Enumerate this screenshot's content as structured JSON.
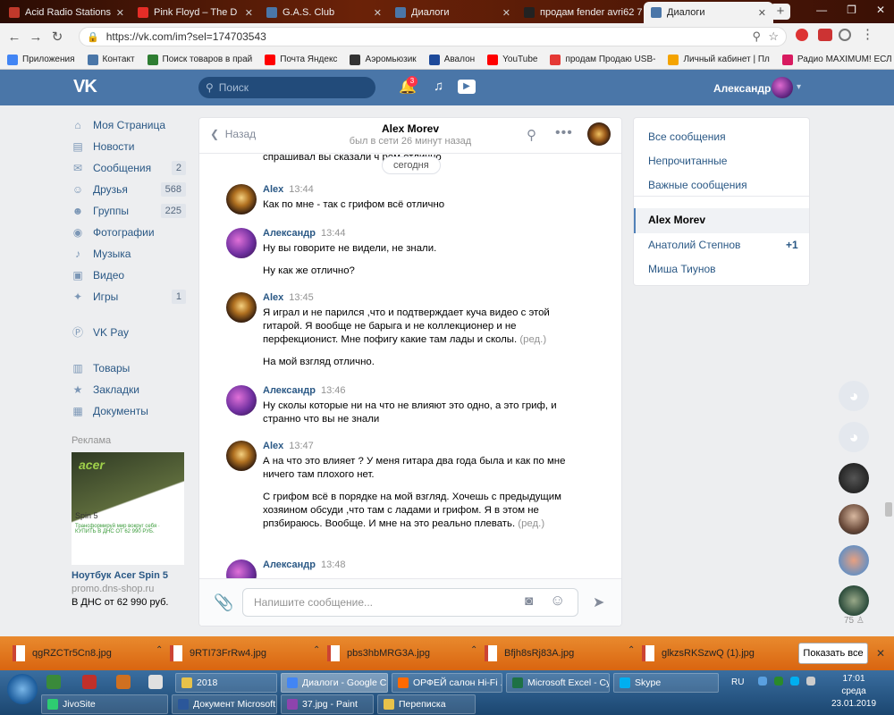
{
  "browser": {
    "tabs": [
      {
        "label": "Acid Radio Stations",
        "color": "#c0392b"
      },
      {
        "label": "Pink Floyd – The D",
        "color": "#e52d27"
      },
      {
        "label": "G.A.S. Club",
        "color": "#4a76a8"
      },
      {
        "label": "Диалоги",
        "color": "#4a76a8"
      },
      {
        "label": "продам fender avri62 7",
        "color": "#222222"
      },
      {
        "label": "Диалоги",
        "color": "#4a76a8"
      }
    ],
    "url": "https://vk.com/im?sel=174703543",
    "bookmarks": [
      {
        "label": "Приложения",
        "color": "#4285f4"
      },
      {
        "label": "Контакт",
        "color": "#4a76a8"
      },
      {
        "label": "Поиск товаров в прай",
        "color": "#2e7d32"
      },
      {
        "label": "Почта Яндекс",
        "color": "#ff0000"
      },
      {
        "label": "Аэромьюзик",
        "color": "#333333"
      },
      {
        "label": "Авалон",
        "color": "#1e4a9a"
      },
      {
        "label": "YouTube",
        "color": "#ff0000"
      },
      {
        "label": "продам Продаю USB-",
        "color": "#e53935"
      },
      {
        "label": "Личный кабинет | Пл",
        "color": "#f4a300"
      },
      {
        "label": "Радио MAXIMUM! ЕСЛ",
        "color": "#d81b60"
      }
    ]
  },
  "vk": {
    "logo": "VK",
    "search_placeholder": "Поиск",
    "notif_count": "3",
    "user_name": "Александр",
    "nav": [
      {
        "label": "Моя Страница",
        "icon": "home-icon",
        "count": ""
      },
      {
        "label": "Новости",
        "icon": "news-icon",
        "count": ""
      },
      {
        "label": "Сообщения",
        "icon": "messages-icon",
        "count": "2"
      },
      {
        "label": "Друзья",
        "icon": "friends-icon",
        "count": "568"
      },
      {
        "label": "Группы",
        "icon": "groups-icon",
        "count": "225"
      },
      {
        "label": "Фотографии",
        "icon": "photo-icon",
        "count": ""
      },
      {
        "label": "Музыка",
        "icon": "music-icon",
        "count": ""
      },
      {
        "label": "Видео",
        "icon": "video-icon",
        "count": ""
      },
      {
        "label": "Игры",
        "icon": "games-icon",
        "count": "1"
      },
      {
        "label": "VK Pay",
        "icon": "vkpay-icon",
        "count": ""
      },
      {
        "label": "Товары",
        "icon": "goods-icon",
        "count": ""
      },
      {
        "label": "Закладки",
        "icon": "bookmark-icon",
        "count": ""
      },
      {
        "label": "Документы",
        "icon": "docs-icon",
        "count": ""
      }
    ],
    "ad": {
      "title": "Реклама",
      "brand": "acer",
      "model": "Spin 5",
      "promo": "Трансформируй мир вокруг себя · КУПИТЬ В ДНС ОТ 62 990 РУБ.",
      "name": "Ноутбук Acer Spin 5",
      "domain": "promo.dns-shop.ru",
      "price": "В ДНС от 62 990 руб."
    }
  },
  "chat": {
    "back_label": "Назад",
    "name": "Alex Morev",
    "status": "был в сети 26 минут назад",
    "date_badge": "сегодня",
    "scrolled_line": "спрашивал вы сказали ч                 ром отлично",
    "edited_label": "(ред.)",
    "messages": [
      {
        "author": "Alex",
        "time": "13:44",
        "lines": [
          "Как по мне - так с грифом всё отлично"
        ]
      },
      {
        "author": "Александр",
        "time": "13:44",
        "lines": [
          "Ну вы говорите не видели, не знали.",
          "Ну как же отлично?"
        ]
      },
      {
        "author": "Alex",
        "time": "13:45",
        "lines": [
          "Я играл и не парился ,что и подтверждает куча видео с этой гитарой. Я вообще не барыга и не коллекционер и не перфекционист. Мне пофигу какие там лады и сколы.",
          "На мой взгляд отлично."
        ]
      },
      {
        "author": "Александр",
        "time": "13:46",
        "lines": [
          "Ну сколы которые ни на что не влияют это одно, а это гриф, и странно что вы не знали"
        ]
      },
      {
        "author": "Alex",
        "time": "13:47",
        "lines": [
          "А на что это влияет ? У меня гитара два года была и как по мне ничего там плохого нет.",
          "С грифом всё в порядке на мой взгляд. Хочешь с предыдущим хозяином обсуди ,что там с ладами и грифом. Я в этом не рпзбираюсь. Вообще. И мне на это реально плевать."
        ]
      },
      {
        "author": "Александр",
        "time": "13:48",
        "lines": [
          ""
        ]
      }
    ],
    "input_placeholder": "Напишите сообщение..."
  },
  "right_panel": {
    "filters": [
      "Все сообщения",
      "Непрочитанные",
      "Важные сообщения"
    ],
    "dialogs": [
      {
        "name": "Alex Morev",
        "count": ""
      },
      {
        "name": "Анатолий Степнов",
        "count": "+1"
      },
      {
        "name": "Миша Тиунов",
        "count": ""
      }
    ]
  },
  "friends_bar": {
    "online_count": "75"
  },
  "downloads": {
    "files": [
      "qgRZCTr5Cn8.jpg",
      "9RTI73FrRw4.jpg",
      "pbs3hbMRG3A.jpg",
      "Bfjh8sRj83A.jpg",
      "glkzsRKSzwQ (1).jpg"
    ],
    "show_all": "Показать все"
  },
  "taskbar": {
    "row1": [
      {
        "label": "2018",
        "color": "#e8c24a"
      },
      {
        "label": "Диалоги - Google C...",
        "color": "#4285f4"
      },
      {
        "label": "ОРФЕЙ салон Hi-Fi ...",
        "color": "#ff6a00"
      },
      {
        "label": "Microsoft Excel - Су...",
        "color": "#1e7145"
      },
      {
        "label": "Skype",
        "color": "#00aff0"
      }
    ],
    "row2": [
      {
        "label": "JivoSite",
        "color": "#2ecc71"
      },
      {
        "label": "Документ Microsoft ...",
        "color": "#2b579a"
      },
      {
        "label": "37.jpg - Paint",
        "color": "#8e44ad"
      },
      {
        "label": "Переписка",
        "color": "#e8c24a"
      }
    ],
    "lang": "RU",
    "time": "17:01",
    "day": "среда",
    "date": "23.01.2019"
  },
  "colors": {
    "vk_blue": "#4a76a8",
    "link": "#2a5885",
    "downloads_bar": "#e46c0a"
  }
}
